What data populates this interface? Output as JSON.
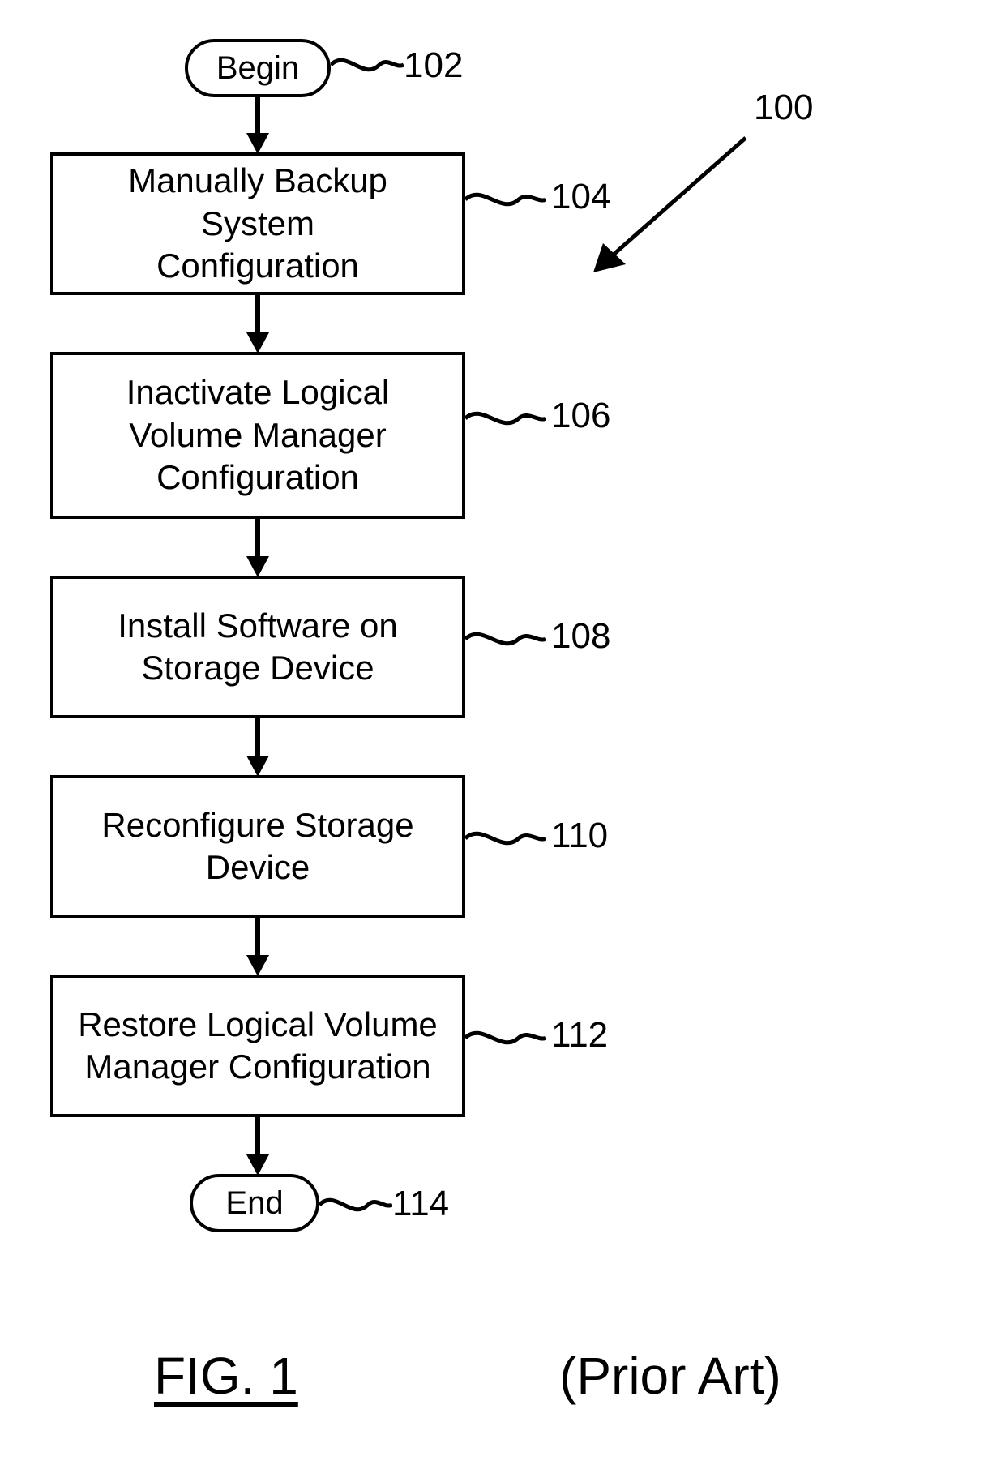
{
  "terminators": {
    "begin": "Begin",
    "end": "End"
  },
  "processes": {
    "p104": "Manually Backup System\nConfiguration",
    "p106": "Inactivate Logical\nVolume Manager\nConfiguration",
    "p108": "Install Software on\nStorage Device",
    "p110": "Reconfigure Storage\nDevice",
    "p112": "Restore Logical Volume\nManager Configuration"
  },
  "labels": {
    "l100": "100",
    "l102": "102",
    "l104": "104",
    "l106": "106",
    "l108": "108",
    "l110": "110",
    "l112": "112",
    "l114": "114"
  },
  "figure": {
    "fig": "FIG. 1",
    "prior": "(Prior Art)"
  }
}
